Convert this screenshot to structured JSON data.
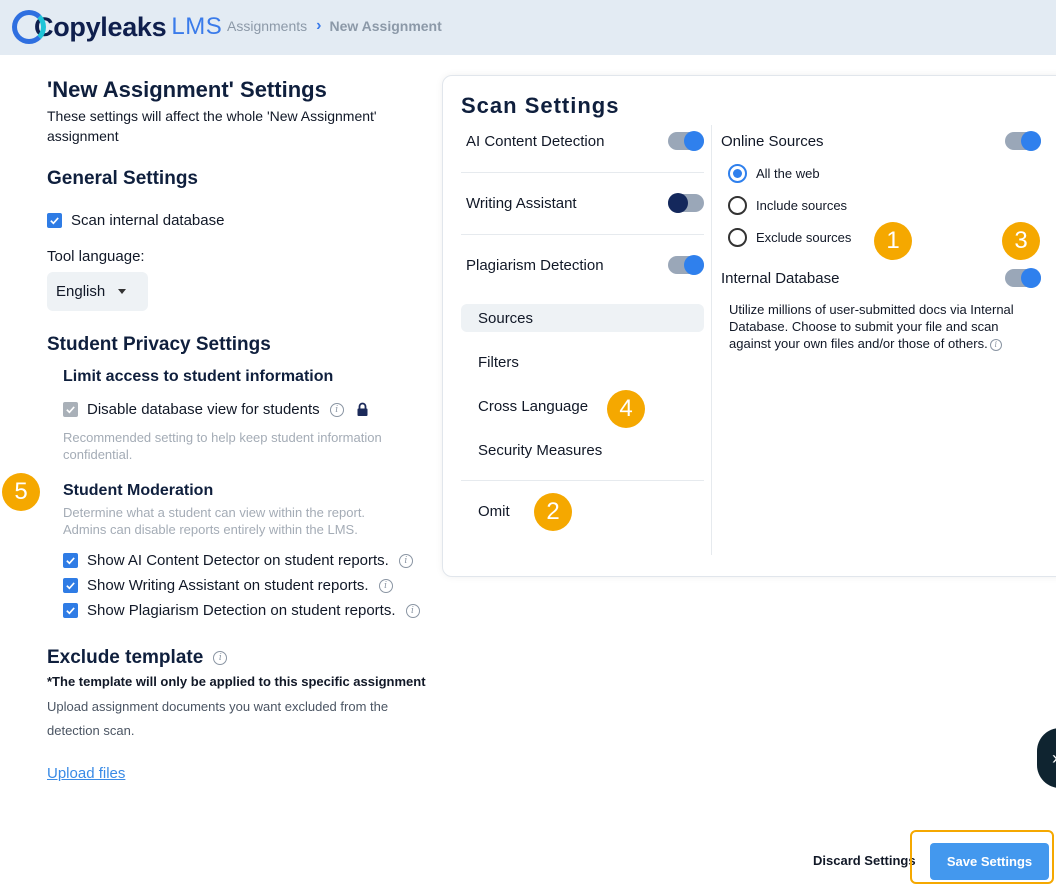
{
  "header": {
    "logo_text": "Copyleaks",
    "logo_suffix": "LMS",
    "breadcrumb": {
      "parent": "Assignments",
      "current": "New Assignment"
    }
  },
  "left": {
    "title": "'New Assignment' Settings",
    "subtitle": "These settings will affect the whole 'New Assignment' assignment",
    "general": {
      "title": "General Settings",
      "scan_internal_label": "Scan internal database",
      "tool_language_label": "Tool language:",
      "language_value": "English"
    },
    "privacy": {
      "title": "Student Privacy Settings",
      "limit_title": "Limit access to student information",
      "disable_db_label": "Disable database view for students",
      "recommended_note": "Recommended setting to help keep student information confidential.",
      "moderation_title": "Student Moderation",
      "moderation_desc": "Determine what a student can view within the report. Admins can disable reports entirely within the LMS.",
      "show_ai_label": "Show AI Content Detector on student reports.",
      "show_writing_label": "Show Writing Assistant on student reports.",
      "show_plag_label": "Show Plagiarism Detection on student reports."
    },
    "exclude": {
      "title": "Exclude template",
      "note": "*The template will only be applied to this specific assignment",
      "desc": "Upload assignment documents you want excluded from the detection scan.",
      "upload_label": "Upload files"
    }
  },
  "scan": {
    "title": "Scan Settings",
    "features": [
      {
        "label": "AI Content Detection",
        "on": true
      },
      {
        "label": "Writing Assistant",
        "on": false
      },
      {
        "label": "Plagiarism Detection",
        "on": true
      }
    ],
    "nav": [
      "Sources",
      "Filters",
      "Cross Language",
      "Security Measures",
      "Omit"
    ],
    "online_sources_label": "Online Sources",
    "radio_options": [
      "All the web",
      "Include sources",
      "Exclude sources"
    ],
    "selected_radio": "All the web",
    "internal_db_label": "Internal Database",
    "internal_db_desc": "Utilize millions of user-submitted docs via Internal Database. Choose to submit your file and scan against your own files and/or those of others."
  },
  "badges": [
    "1",
    "2",
    "3",
    "4",
    "5"
  ],
  "footer": {
    "discard_label": "Discard Settings",
    "save_label": "Save Settings"
  },
  "colors": {
    "accent": "#2f80ed",
    "badge": "#f5a800",
    "header_bg": "#e3ebf3"
  }
}
